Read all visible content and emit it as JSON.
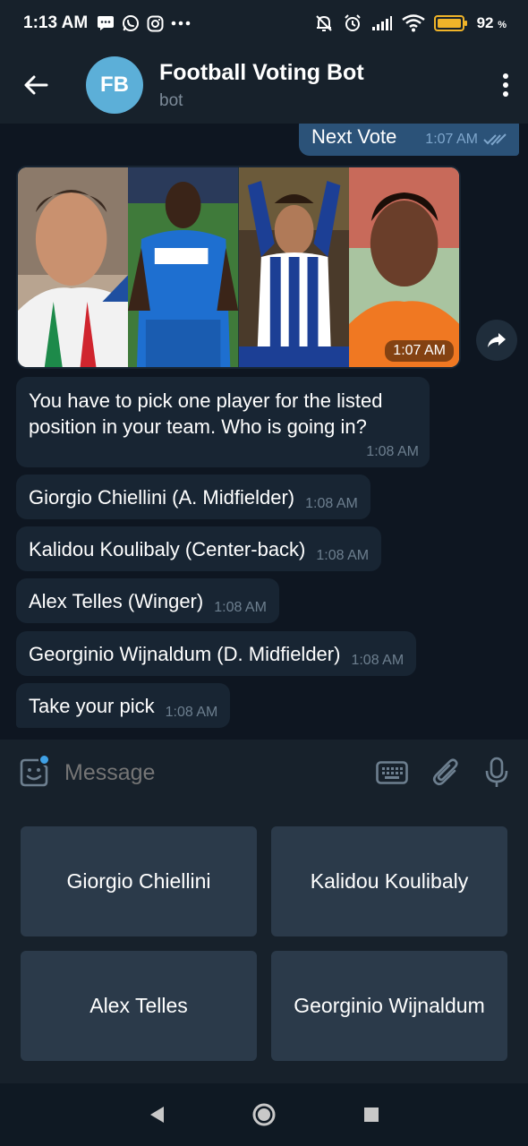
{
  "status_bar": {
    "time": "1:13 AM",
    "battery_percent": "92",
    "battery_unit": "%",
    "left_icons": [
      "message-icon",
      "whatsapp-icon",
      "instagram-icon",
      "more-dots-icon"
    ],
    "right_icons": [
      "silent-icon",
      "alarm-icon",
      "signal-icon",
      "wifi-icon",
      "battery-icon"
    ]
  },
  "header": {
    "avatar_initials": "FB",
    "title": "Football Voting Bot",
    "subtitle": "bot",
    "avatar_color": "#5cafd8"
  },
  "chat": {
    "outgoing": {
      "text": "Next Vote",
      "time": "1:07 AM",
      "status": "read"
    },
    "photo": {
      "time": "1:07 AM",
      "players_shown": 4
    },
    "messages": [
      {
        "text": "You have to pick one player for the listed position in your team. Who is going in?",
        "time": "1:08 AM"
      },
      {
        "text": "Giorgio Chiellini (A. Midfielder)",
        "time": "1:08 AM"
      },
      {
        "text": "Kalidou Koulibaly (Center-back)",
        "time": "1:08 AM"
      },
      {
        "text": "Alex Telles (Winger)",
        "time": "1:08 AM"
      },
      {
        "text": "Georginio Wijnaldum (D. Midfielder)",
        "time": "1:08 AM"
      },
      {
        "text": "Take your pick",
        "time": "1:08 AM"
      }
    ]
  },
  "input": {
    "placeholder": "Message"
  },
  "keyboard": {
    "buttons": [
      "Giorgio Chiellini",
      "Kalidou Koulibaly",
      "Alex Telles",
      "Georginio Wijnaldum"
    ]
  },
  "colors": {
    "accent": "#5cafd8",
    "chat_bg": "#0e1621",
    "bubble_in": "#182533",
    "bubble_out": "#2b5278",
    "keyboard_button": "#2b3a4a"
  }
}
